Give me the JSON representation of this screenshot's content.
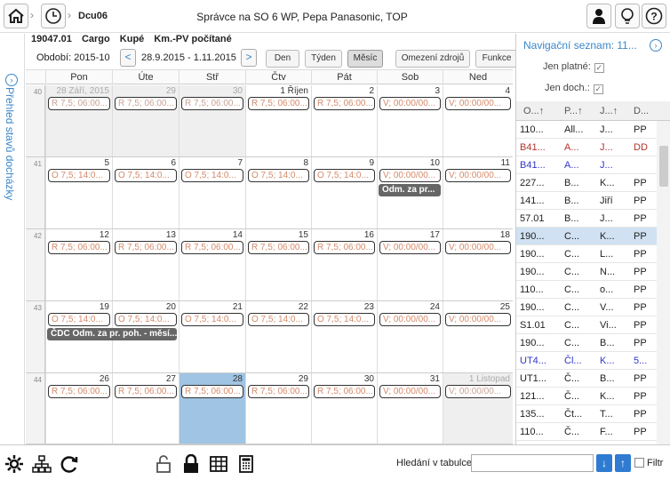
{
  "header": {
    "breadcrumb": "Dcu06",
    "title": "Správce na SO 6 WP, Pepa Panasonic, TOP"
  },
  "sidebar": {
    "label": "Přehled stavů docházky"
  },
  "context": {
    "id": "19047.01",
    "c1": "Cargo",
    "c2": "Kupé",
    "c3": "Km.-PV počítané"
  },
  "toolbar": {
    "period_label": "Období: 2015-10",
    "range": "28.9.2015 - 1.11.2015",
    "prev": "<",
    "next": ">",
    "views": [
      "Den",
      "Týden",
      "Měsíc",
      "Omezení zdrojů",
      "Funkce"
    ],
    "active_view": "Měsíc"
  },
  "calendar": {
    "days": [
      "Pon",
      "Úte",
      "Stř",
      "Čtv",
      "Pát",
      "Sob",
      "Ned"
    ],
    "weeks": [
      {
        "num": "40",
        "cells": [
          {
            "d": "28 Září, 2015",
            "fade": true,
            "grey": true,
            "chip": "R 7,5; 06:00..."
          },
          {
            "d": "29",
            "fade": true,
            "grey": true,
            "chip": "R 7,5; 06:00..."
          },
          {
            "d": "30",
            "fade": true,
            "grey": true,
            "chip": "R 7,5; 06:00..."
          },
          {
            "d": "1 Říjen",
            "chip": "R 7,5; 06:00..."
          },
          {
            "d": "2",
            "chip": "R 7,5; 06:00..."
          },
          {
            "d": "3",
            "chip": "V; 00:00/00..."
          },
          {
            "d": "4",
            "chip": "V; 00:00/00..."
          }
        ]
      },
      {
        "num": "41",
        "cells": [
          {
            "d": "5",
            "chip": "O 7,5; 14:0..."
          },
          {
            "d": "6",
            "chip": "O 7,5; 14:0..."
          },
          {
            "d": "7",
            "chip": "O 7,5; 14:0..."
          },
          {
            "d": "8",
            "chip": "O 7,5; 14:0..."
          },
          {
            "d": "9",
            "chip": "O 7,5; 14:0..."
          },
          {
            "d": "10",
            "chip": "V; 00:00/00..."
          },
          {
            "d": "11",
            "chip": "V; 00:00/00..."
          }
        ]
      },
      {
        "num": "42",
        "cells": [
          {
            "d": "12",
            "chip": "R 7,5; 06:00..."
          },
          {
            "d": "13",
            "chip": "R 7,5; 06:00..."
          },
          {
            "d": "14",
            "chip": "R 7,5; 06:00..."
          },
          {
            "d": "15",
            "chip": "R 7,5; 06:00..."
          },
          {
            "d": "16",
            "chip": "R 7,5; 06:00..."
          },
          {
            "d": "17",
            "chip": "V; 00:00/00..."
          },
          {
            "d": "18",
            "chip": "V; 00:00/00..."
          }
        ]
      },
      {
        "num": "43",
        "cells": [
          {
            "d": "19",
            "chip": "O 7,5; 14:0..."
          },
          {
            "d": "20",
            "chip": "O 7,5; 14:0..."
          },
          {
            "d": "21",
            "chip": "O 7,5; 14:0..."
          },
          {
            "d": "22",
            "chip": "O 7,5; 14:0..."
          },
          {
            "d": "23",
            "chip": "O 7,5; 14:0..."
          },
          {
            "d": "24",
            "chip": "V; 00:00/00..."
          },
          {
            "d": "25",
            "chip": "V; 00:00/00..."
          }
        ]
      },
      {
        "num": "44",
        "cells": [
          {
            "d": "26",
            "chip": "R 7,5; 06:00..."
          },
          {
            "d": "27",
            "chip": "R 7,5; 06:00..."
          },
          {
            "d": "28",
            "sel": true,
            "chip": "R 7,5; 06:00..."
          },
          {
            "d": "29",
            "chip": "R 7,5; 06:00..."
          },
          {
            "d": "30",
            "chip": "R 7,5; 06:00..."
          },
          {
            "d": "31",
            "chip": "V; 00:00/00..."
          },
          {
            "d": "1 Listopad",
            "fade": true,
            "grey": true,
            "chip": "V; 00:00/00..."
          }
        ]
      }
    ],
    "events": [
      {
        "week": 1,
        "text": "Odm. za pr..."
      },
      {
        "week": 3,
        "text": "ČDC Odm. za pr. poh. - měsí..."
      }
    ]
  },
  "nav": {
    "title": "Navigační seznam: 11...",
    "filter1": "Jen platné:",
    "filter2": "Jen doch.:",
    "check": "✓",
    "cols": [
      "O...↑",
      "P...↑",
      "J...↑",
      "D..."
    ],
    "rows": [
      {
        "a": "110...",
        "b": "All...",
        "c": "J...",
        "d": "PP",
        "cls": ""
      },
      {
        "a": "B41...",
        "b": "A...",
        "c": "J...",
        "d": "DD",
        "cls": "red"
      },
      {
        "a": "B41...",
        "b": "A...",
        "c": "J...",
        "d": "",
        "cls": "blue"
      },
      {
        "a": "227...",
        "b": "B...",
        "c": "K...",
        "d": "PP",
        "cls": ""
      },
      {
        "a": "141...",
        "b": "B...",
        "c": "Jiří",
        "d": "PP",
        "cls": ""
      },
      {
        "a": "57.01",
        "b": "B...",
        "c": "J...",
        "d": "PP",
        "cls": ""
      },
      {
        "a": "190...",
        "b": "C...",
        "c": "K...",
        "d": "PP",
        "cls": "hl"
      },
      {
        "a": "190...",
        "b": "C...",
        "c": "L...",
        "d": "PP",
        "cls": ""
      },
      {
        "a": "190...",
        "b": "C...",
        "c": "N...",
        "d": "PP",
        "cls": ""
      },
      {
        "a": "110...",
        "b": "C...",
        "c": "o...",
        "d": "PP",
        "cls": ""
      },
      {
        "a": "190...",
        "b": "C...",
        "c": "V...",
        "d": "PP",
        "cls": ""
      },
      {
        "a": "S1.01",
        "b": "C...",
        "c": "Vi...",
        "d": "PP",
        "cls": ""
      },
      {
        "a": "190...",
        "b": "C...",
        "c": "B...",
        "d": "PP",
        "cls": ""
      },
      {
        "a": "UT4...",
        "b": "Čl...",
        "c": "K...",
        "d": "5...",
        "cls": "blue"
      },
      {
        "a": "UT1...",
        "b": "Č...",
        "c": "B...",
        "d": "PP",
        "cls": ""
      },
      {
        "a": "121...",
        "b": "Č...",
        "c": "K...",
        "d": "PP",
        "cls": ""
      },
      {
        "a": "135...",
        "b": "Čt...",
        "c": "T...",
        "d": "PP",
        "cls": ""
      },
      {
        "a": "110...",
        "b": "Č...",
        "c": "F...",
        "d": "PP",
        "cls": ""
      }
    ]
  },
  "footer": {
    "search_label": "Hledání v tabulce:",
    "search_value": "",
    "down": "↓",
    "up": "↑",
    "filter_label": "Filtr"
  }
}
